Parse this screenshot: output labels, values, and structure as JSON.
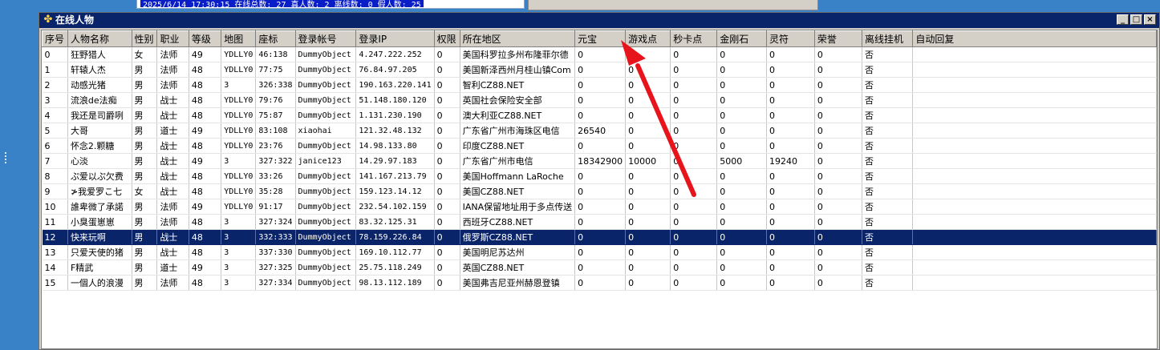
{
  "background_status": {
    "text": "2025/6/14 17:30:15 在线总数: 27 真人数: 2 离线数: 0 假人数: 25"
  },
  "window": {
    "title": "在线人物",
    "controls": {
      "minimize": "_",
      "maximize": "□",
      "close": "×"
    }
  },
  "table": {
    "columns": [
      "序号",
      "人物名称",
      "性别",
      "职业",
      "等级",
      "地图",
      "座标",
      "登录帐号",
      "登录IP",
      "权限",
      "所在地区",
      "元宝",
      "游戏点",
      "秒卡点",
      "金刚石",
      "灵符",
      "荣誉",
      "离线挂机",
      "自动回复"
    ],
    "selected_row": 12,
    "rows": [
      [
        "0",
        "狂野猎人",
        "女",
        "法师",
        "49",
        "YDLLY0",
        "46:138",
        "DummyObject",
        "4.247.222.252",
        "0",
        "美国科罗拉多州布隆菲尔德",
        "0",
        "0",
        "0",
        "0",
        "0",
        "0",
        "否",
        ""
      ],
      [
        "1",
        "轩辕人杰",
        "男",
        "法师",
        "48",
        "YDLLY0",
        "77:75",
        "DummyObject",
        "76.84.97.205",
        "0",
        "美国新泽西州月桂山镇Com",
        "0",
        "0",
        "0",
        "0",
        "0",
        "0",
        "否",
        ""
      ],
      [
        "2",
        "动感光猪",
        "男",
        "法师",
        "48",
        "3",
        "326:338",
        "DummyObject",
        "190.163.220.141",
        "0",
        "智利CZ88.NET",
        "0",
        "0",
        "0",
        "0",
        "0",
        "0",
        "否",
        ""
      ],
      [
        "3",
        "流浪de法痴",
        "男",
        "战士",
        "48",
        "YDLLY0",
        "79:76",
        "DummyObject",
        "51.148.180.120",
        "0",
        "英国社会保险安全部",
        "0",
        "0",
        "0",
        "0",
        "0",
        "0",
        "否",
        ""
      ],
      [
        "4",
        "我还是司爵咧",
        "男",
        "战士",
        "48",
        "YDLLY0",
        "75:87",
        "DummyObject",
        "1.131.230.190",
        "0",
        "澳大利亚CZ88.NET",
        "0",
        "0",
        "0",
        "0",
        "0",
        "0",
        "否",
        ""
      ],
      [
        "5",
        "大哥",
        "男",
        "道士",
        "49",
        "YDLLY0",
        "83:108",
        "xiaohai",
        "121.32.48.132",
        "0",
        "广东省广州市海珠区电信",
        "26540",
        "0",
        "0",
        "0",
        "0",
        "0",
        "否",
        ""
      ],
      [
        "6",
        "怀念2.颗糖",
        "男",
        "战士",
        "48",
        "YDLLY0",
        "23:76",
        "DummyObject",
        "14.98.133.80",
        "0",
        "印度CZ88.NET",
        "0",
        "0",
        "0",
        "0",
        "0",
        "0",
        "否",
        ""
      ],
      [
        "7",
        "心淡",
        "男",
        "战士",
        "49",
        "3",
        "327:322",
        "janice123",
        "14.29.97.183",
        "0",
        "广东省广州市电信",
        "18342900",
        "10000",
        "0",
        "5000",
        "19240",
        "0",
        "否",
        ""
      ],
      [
        "8",
        "ぷ爱以ぷ欠费",
        "男",
        "战士",
        "48",
        "YDLLY0",
        "33:26",
        "DummyObject",
        "141.167.213.79",
        "0",
        "美国Hoffmann LaRoche",
        "0",
        "0",
        "0",
        "0",
        "0",
        "0",
        "否",
        ""
      ],
      [
        "9",
        "≯我爱罗こ七",
        "女",
        "战士",
        "48",
        "YDLLY0",
        "35:28",
        "DummyObject",
        "159.123.14.12",
        "0",
        "美国CZ88.NET",
        "0",
        "0",
        "0",
        "0",
        "0",
        "0",
        "否",
        ""
      ],
      [
        "10",
        "誰卑微了承諾",
        "男",
        "法师",
        "49",
        "YDLLY0",
        "91:17",
        "DummyObject",
        "232.54.102.159",
        "0",
        "IANA保留地址用于多点传送",
        "0",
        "0",
        "0",
        "0",
        "0",
        "0",
        "否",
        ""
      ],
      [
        "11",
        "小臭蛋崽崽",
        "男",
        "法师",
        "48",
        "3",
        "327:324",
        "DummyObject",
        "83.32.125.31",
        "0",
        "西班牙CZ88.NET",
        "0",
        "0",
        "0",
        "0",
        "0",
        "0",
        "否",
        ""
      ],
      [
        "12",
        "快来玩啊",
        "男",
        "战士",
        "48",
        "3",
        "332:333",
        "DummyObject",
        "78.159.226.84",
        "0",
        "俄罗斯CZ88.NET",
        "0",
        "0",
        "0",
        "0",
        "0",
        "0",
        "否",
        ""
      ],
      [
        "13",
        "只爱天使的猪",
        "男",
        "战士",
        "48",
        "3",
        "337:330",
        "DummyObject",
        "169.10.112.77",
        "0",
        "美国明尼苏达州",
        "0",
        "0",
        "0",
        "0",
        "0",
        "0",
        "否",
        ""
      ],
      [
        "14",
        "F精武",
        "男",
        "道士",
        "49",
        "3",
        "327:325",
        "DummyObject",
        "25.75.118.249",
        "0",
        "英国CZ88.NET",
        "0",
        "0",
        "0",
        "0",
        "0",
        "0",
        "否",
        ""
      ],
      [
        "15",
        "一個人的浪漫",
        "男",
        "法师",
        "48",
        "3",
        "327:334",
        "DummyObject",
        "98.13.112.189",
        "0",
        "美国弗吉尼亚州赫恩登镇",
        "0",
        "0",
        "0",
        "0",
        "0",
        "0",
        "否",
        ""
      ]
    ]
  },
  "annotation": {
    "type": "red-arrow",
    "points_to_column": "游戏点",
    "color": "#e8141c"
  },
  "colors": {
    "selection": "#0a246a",
    "title_bar": "#0a246a",
    "desktop": "#3a82c8",
    "annotation": "#e8141c"
  },
  "icons": {
    "title": "window-app-icon"
  }
}
